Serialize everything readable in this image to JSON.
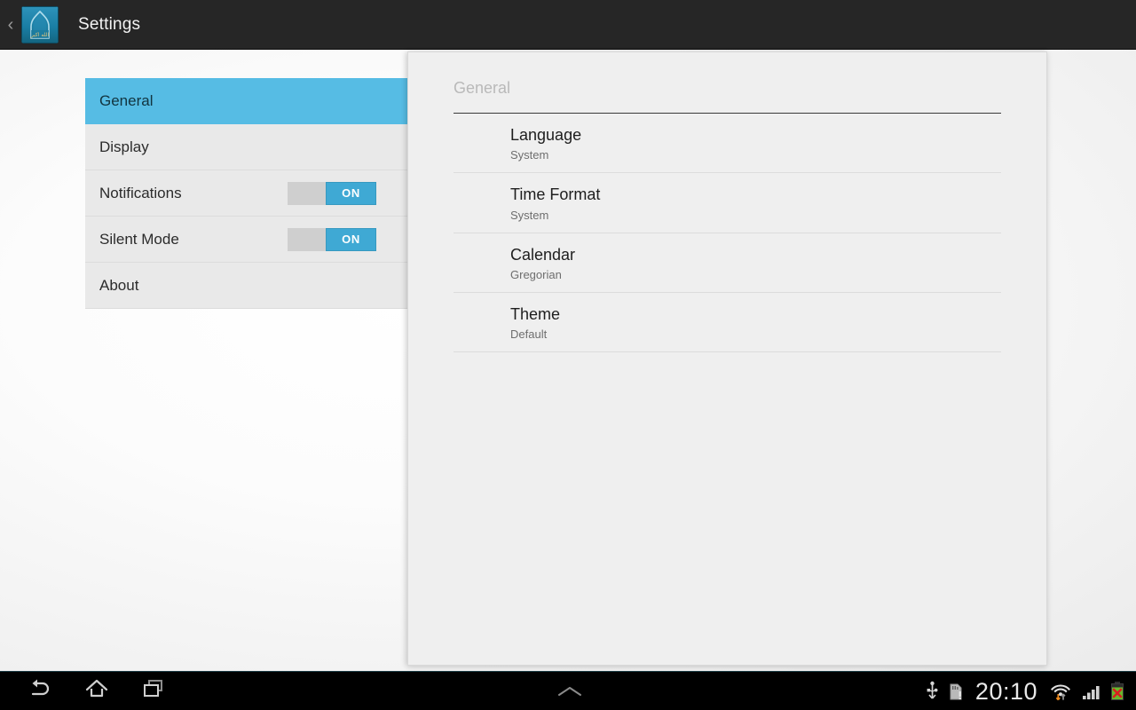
{
  "action_bar": {
    "back_label": "‹",
    "app_icon_name": "mosque-app-icon",
    "title": "Settings"
  },
  "sidebar": {
    "items": [
      {
        "label": "General",
        "selected": true,
        "has_switch": false,
        "switch_state": ""
      },
      {
        "label": "Display",
        "selected": false,
        "has_switch": false,
        "switch_state": ""
      },
      {
        "label": "Notifications",
        "selected": false,
        "has_switch": true,
        "switch_state": "ON"
      },
      {
        "label": "Silent Mode",
        "selected": false,
        "has_switch": true,
        "switch_state": "ON"
      },
      {
        "label": "About",
        "selected": false,
        "has_switch": false,
        "switch_state": ""
      }
    ]
  },
  "detail_panel": {
    "header": "General",
    "preferences": [
      {
        "title": "Language",
        "summary": "System"
      },
      {
        "title": "Time Format",
        "summary": "System"
      },
      {
        "title": "Calendar",
        "summary": "Gregorian"
      },
      {
        "title": "Theme",
        "summary": "Default"
      }
    ]
  },
  "system_bar": {
    "nav": [
      {
        "name": "back-button",
        "label": "Back"
      },
      {
        "name": "home-button",
        "label": "Home"
      },
      {
        "name": "recent-apps-button",
        "label": "Recent apps"
      }
    ],
    "ime_switcher": "keyboard-chevron-up",
    "status": {
      "usb_icon": "usb-icon",
      "sdcard_icon": "sdcard-alert-icon",
      "clock": "20:10",
      "wifi_icon": "wifi-data-activity-icon",
      "signal_icon": "cellular-signal-icon",
      "battery_icon": "battery-error-icon"
    }
  },
  "colors": {
    "accent_blue": "#56bce4",
    "switch_blue": "#3fa9d4",
    "action_bar": "#262626",
    "panel_bg": "#efefef",
    "sidebar_item_bg": "#e9e9e9"
  }
}
